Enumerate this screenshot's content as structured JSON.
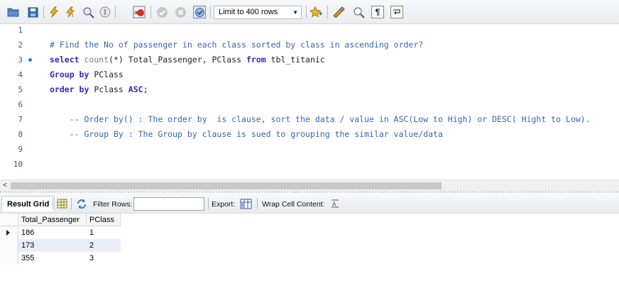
{
  "toolbar": {
    "limit_value": "Limit to 400 rows",
    "icons": [
      "open-folder-icon",
      "save-icon",
      "execute-icon",
      "execute-current-icon",
      "explain-icon",
      "stop-icon",
      "toggle-error-icon",
      "commit-icon",
      "rollback-icon",
      "autocommit-icon",
      "beautify-icon",
      "find-icon",
      "invisible-chars-icon",
      "wrap-icon"
    ]
  },
  "editor": {
    "lines": [
      {
        "num": "1",
        "segments": []
      },
      {
        "num": "2",
        "segments": [
          {
            "cls": "cmt",
            "text": "# Find the No of passenger in each class sorted by class in ascending order?"
          }
        ]
      },
      {
        "num": "3",
        "marker": true,
        "segments": [
          {
            "cls": "kw",
            "text": "select "
          },
          {
            "cls": "fn",
            "text": "count"
          },
          {
            "cls": "txt",
            "text": "(*) Total_Passenger, PClass "
          },
          {
            "cls": "kw",
            "text": "from "
          },
          {
            "cls": "txt",
            "text": "tbl_titanic"
          }
        ]
      },
      {
        "num": "4",
        "segments": [
          {
            "cls": "kw",
            "text": "Group by "
          },
          {
            "cls": "txt",
            "text": "PClass"
          }
        ]
      },
      {
        "num": "5",
        "segments": [
          {
            "cls": "kw",
            "text": "order by "
          },
          {
            "cls": "txt",
            "text": "Pclass "
          },
          {
            "cls": "kw",
            "text": "ASC"
          },
          {
            "cls": "txt",
            "text": ";"
          }
        ]
      },
      {
        "num": "6",
        "segments": []
      },
      {
        "num": "7",
        "segments": [
          {
            "cls": "cmt",
            "text": "    -- Order by() : The order by  is clause, sort the data / value in ASC(Low to High) or DESC( Hight to Low)."
          }
        ]
      },
      {
        "num": "8",
        "segments": [
          {
            "cls": "cmt",
            "text": "    -- Group By : The Group by clause is sued to grouping the similar value/data"
          }
        ]
      },
      {
        "num": "9",
        "segments": []
      },
      {
        "num": "10",
        "segments": []
      }
    ]
  },
  "results": {
    "tab_label": "Result Grid",
    "filter_label": "Filter Rows:",
    "filter_value": "",
    "export_label": "Export:",
    "wrap_label": "Wrap Cell Content:",
    "columns": [
      "Total_Passenger",
      "PClass"
    ],
    "rows": [
      [
        "186",
        "1"
      ],
      [
        "173",
        "2"
      ],
      [
        "355",
        "3"
      ]
    ]
  },
  "colors": {
    "comment": "#3a64b0",
    "keyword": "#2a2dbc",
    "selected_row": "#e8eef8"
  }
}
